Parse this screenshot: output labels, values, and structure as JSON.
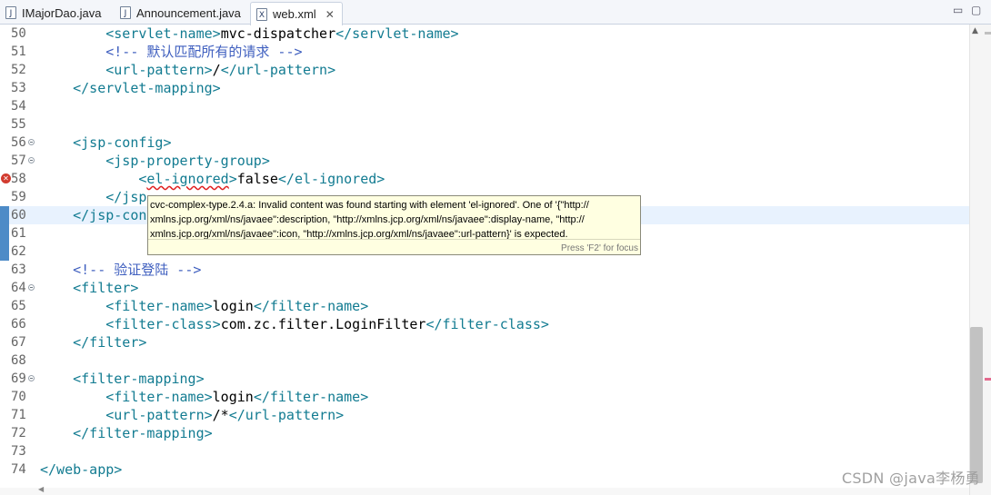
{
  "tabs": [
    {
      "label": "IMajorDao.java",
      "icon": "java-file-icon"
    },
    {
      "label": "Announcement.java",
      "icon": "java-file-icon"
    },
    {
      "label": "web.xml",
      "icon": "xml-file-icon",
      "active": true,
      "close": "✕"
    }
  ],
  "window_controls": {
    "minimize": "▭",
    "maximize": "▢"
  },
  "lines": [
    {
      "n": "50"
    },
    {
      "n": "51"
    },
    {
      "n": "52"
    },
    {
      "n": "53"
    },
    {
      "n": "54"
    },
    {
      "n": "55"
    },
    {
      "n": "56"
    },
    {
      "n": "57"
    },
    {
      "n": "58"
    },
    {
      "n": "59"
    },
    {
      "n": "60"
    },
    {
      "n": "61"
    },
    {
      "n": "62"
    },
    {
      "n": "63"
    },
    {
      "n": "64"
    },
    {
      "n": "65"
    },
    {
      "n": "66"
    },
    {
      "n": "67"
    },
    {
      "n": "68"
    },
    {
      "n": "69"
    },
    {
      "n": "70"
    },
    {
      "n": "71"
    },
    {
      "n": "72"
    },
    {
      "n": "73"
    },
    {
      "n": "74"
    }
  ],
  "code": {
    "l50": {
      "indent": "        ",
      "t1": "<servlet-name>",
      "txt": "mvc-dispatcher",
      "t2": "</servlet-name>"
    },
    "l51": {
      "indent": "        ",
      "c": "<!-- 默认匹配所有的请求 -->"
    },
    "l52": {
      "indent": "        ",
      "t1": "<url-pattern>",
      "txt": "/",
      "t2": "</url-pattern>"
    },
    "l53": {
      "indent": "    ",
      "t1": "</servlet-mapping>"
    },
    "l56": {
      "indent": "    ",
      "t1": "<jsp-config>"
    },
    "l57": {
      "indent": "        ",
      "t1": "<jsp-property-group>"
    },
    "l58": {
      "indent": "            ",
      "t0": "<",
      "terr": "el-ignored",
      "t0b": ">",
      "txt": "false",
      "t2": "</el-ignored>"
    },
    "l59": {
      "indent": "        ",
      "t1": "</jsp"
    },
    "l60": {
      "indent": "    ",
      "t1": "</jsp-con"
    },
    "l63": {
      "indent": "    ",
      "c": "<!-- 验证登陆 -->"
    },
    "l64": {
      "indent": "    ",
      "t1": "<filter>"
    },
    "l65": {
      "indent": "        ",
      "t1": "<filter-name>",
      "txt": "login",
      "t2": "</filter-name>"
    },
    "l66": {
      "indent": "        ",
      "t1": "<filter-class>",
      "txt": "com.zc.filter.LoginFilter",
      "t2": "</filter-class>"
    },
    "l67": {
      "indent": "    ",
      "t1": "</filter>"
    },
    "l69": {
      "indent": "    ",
      "t1": "<filter-mapping>"
    },
    "l70": {
      "indent": "        ",
      "t1": "<filter-name>",
      "txt": "login",
      "t2": "</filter-name>"
    },
    "l71": {
      "indent": "        ",
      "t1": "<url-pattern>",
      "txt": "/*",
      "t2": "</url-pattern>"
    },
    "l72": {
      "indent": "    ",
      "t1": "</filter-mapping>"
    },
    "l74": {
      "indent": "",
      "t1": "</web-app>"
    }
  },
  "tooltip": {
    "line1": "cvc-complex-type.2.4.a: Invalid content was found starting with element 'el-ignored'. One of '{\"http://",
    "line2": "xmlns.jcp.org/xml/ns/javaee\":description, \"http://xmlns.jcp.org/xml/ns/javaee\":display-name, \"http://",
    "line3": "xmlns.jcp.org/xml/ns/javaee\":icon, \"http://xmlns.jcp.org/xml/ns/javaee\":url-pattern}' is expected.",
    "footer": "Press 'F2' for focus"
  },
  "watermark": "CSDN @java李杨勇",
  "colors": {
    "tag": "#127b91",
    "comment": "#3f5fbf",
    "current_line": "#e8f2fe",
    "tooltip_bg": "#ffffe1"
  }
}
